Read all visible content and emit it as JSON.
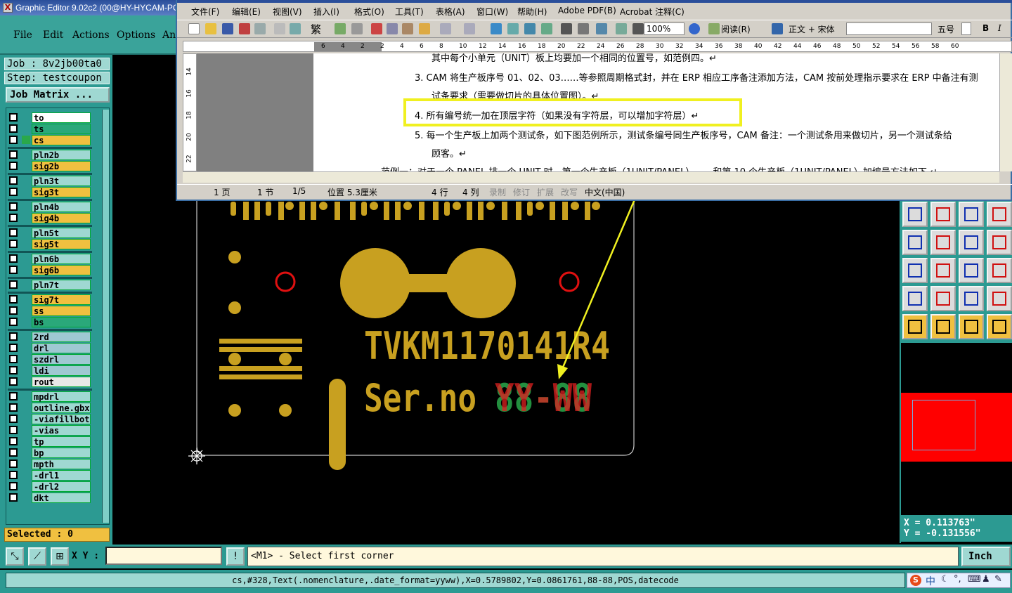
{
  "graphic_editor": {
    "title": "Graphic Editor 9.02c2 (00@HY-HYCAM-PC",
    "menu": [
      "File",
      "Edit",
      "Actions",
      "Options",
      "An"
    ],
    "job": "Job : 8v2jb00ta0",
    "step": "Step: testcoupon",
    "job_matrix_label": "Job Matrix ...",
    "layers": [
      {
        "name": "to",
        "color": "#ffffff"
      },
      {
        "name": "ts",
        "color": "#2aa87a"
      },
      {
        "name": "cs",
        "color": "#f0c040"
      },
      {
        "name": "pln2b",
        "color": "#9fd8d2"
      },
      {
        "name": "sig2b",
        "color": "#f0c040"
      },
      {
        "name": "pln3t",
        "color": "#9fd8d2"
      },
      {
        "name": "sig3t",
        "color": "#f0c040"
      },
      {
        "name": "pln4b",
        "color": "#9fd8d2"
      },
      {
        "name": "sig4b",
        "color": "#f0c040"
      },
      {
        "name": "pln5t",
        "color": "#9fd8d2"
      },
      {
        "name": "sig5t",
        "color": "#f0c040"
      },
      {
        "name": "pln6b",
        "color": "#9fd8d2"
      },
      {
        "name": "sig6b",
        "color": "#f0c040"
      },
      {
        "name": "pln7t",
        "color": "#9fd8d2"
      },
      {
        "name": "sig7t",
        "color": "#f0c040"
      },
      {
        "name": "ss",
        "color": "#f0c040"
      },
      {
        "name": "bs",
        "color": "#2aa87a"
      },
      {
        "name": "2rd",
        "color": "#9fc8d2"
      },
      {
        "name": "drl",
        "color": "#9fc8d2"
      },
      {
        "name": "szdrl",
        "color": "#9fc8d2"
      },
      {
        "name": "ldi",
        "color": "#9fc8d2"
      },
      {
        "name": "rout",
        "color": "#e8e8e8"
      },
      {
        "name": "mpdrl",
        "color": "#9fd8d2"
      },
      {
        "name": "outline.gbx",
        "color": "#9fd8d2"
      },
      {
        "name": "-viafillbot",
        "color": "#9fd8d2"
      },
      {
        "name": "-vias",
        "color": "#9fd8d2"
      },
      {
        "name": "tp",
        "color": "#9fd8d2"
      },
      {
        "name": "bp",
        "color": "#9fd8d2"
      },
      {
        "name": "mpth",
        "color": "#9fd8d2"
      },
      {
        "name": "-drl1",
        "color": "#9fd8d2"
      },
      {
        "name": "-drl2",
        "color": "#9fd8d2"
      },
      {
        "name": "dkt",
        "color": "#9fd8d2"
      }
    ],
    "selected": "Selected : 0",
    "xy_label": "X Y :",
    "xy_value": "",
    "prompt": "<M1> - Select first corner",
    "unit": "Inch",
    "status_line": "cs,#328,Text(.nomenclature,.date_format=yyww),X=0.5789802,Y=0.0861761,88-88,POS,datecode",
    "coords": {
      "x": "X = 0.113763\"",
      "y": "Y = -0.131556\""
    }
  },
  "pcb": {
    "board_text": "TVKM1170141R4",
    "ser_label": "Ser.no",
    "ser_overlay_red": "YY-WW",
    "ser_overlay_green": "88-88"
  },
  "word": {
    "menu": [
      "文件(F)",
      "编辑(E)",
      "视图(V)",
      "插入(I)",
      "格式(O)",
      "工具(T)",
      "表格(A)",
      "窗口(W)",
      "帮助(H)",
      "Adobe PDF(B)",
      "Acrobat 注释(C)"
    ],
    "toolbar": {
      "fan": "繁",
      "zoom": "100%",
      "read": "阅读(R)",
      "style": "正文 + 宋体",
      "font_size": "五号",
      "bold": "B",
      "italic": "I"
    },
    "ruler_numbers": [
      "6",
      "4",
      "2",
      "2",
      "4",
      "6",
      "8",
      "10",
      "12",
      "14",
      "16",
      "18",
      "20",
      "22",
      "24",
      "26",
      "28",
      "30",
      "32",
      "34",
      "36",
      "38",
      "40",
      "42",
      "44",
      "46",
      "48",
      "50",
      "52",
      "54",
      "56",
      "58",
      "60"
    ],
    "vruler_numbers": [
      "14",
      "16",
      "18",
      "20",
      "22"
    ],
    "doc_lines": [
      "其中每个小单元（UNIT）板上均要加一个相同的位置号，如范例四。↵",
      "3.   CAM 将生产板序号 01、02、03……等参照周期格式封，并在 ERP 相应工序备注添加方法，CAM 按前处理指示要求在 ERP 中备注有测",
      "试条要求（需要做切片的具体位置图）。↵",
      "4.   所有编号统一加在顶层字符（如果没有字符层，可以增加字符层）↵",
      "5.   每一个生产板上加两个测试条，如下图范例所示，测试条编号同生产板序号，CAM 备注：一个测试条用来做切片，另一个测试条给",
      "顾客。↵",
      "范例一：对于一个 PANEL 排一个 UNIT 时，第一个生产板（1UNIT/PANEL）……和第 10 个生产板（1UNIT/PANEL）加编号方法如下 ↵"
    ],
    "status": {
      "page": "1 页",
      "section": "1 节",
      "pages": "1/5",
      "position": "位置 5.3厘米",
      "line": "4 行",
      "col": "4 列",
      "rec": "录制",
      "trk": "修订",
      "ext": "扩展",
      "ovr": "改写",
      "lang": "中文(中国)"
    }
  },
  "tray": {
    "ime": "中"
  },
  "colors": {
    "teal": "#2c9a92",
    "gold": "#c8a020",
    "annotation": "#f0f020"
  }
}
